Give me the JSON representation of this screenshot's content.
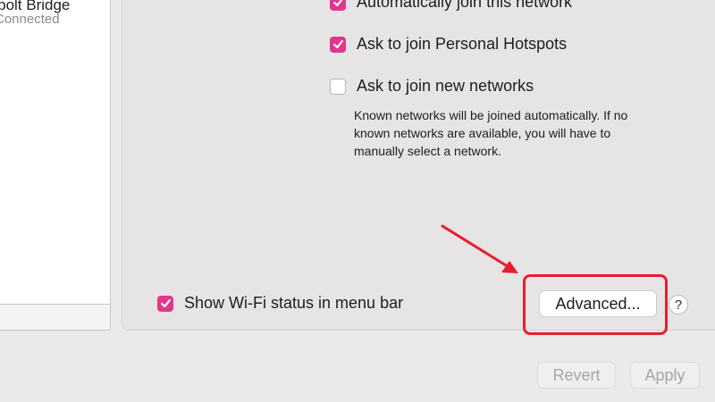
{
  "sidebar": {
    "network_name": "erbolt Bridge",
    "network_status": "Connected"
  },
  "options": {
    "auto_join": {
      "label": "Automatically join this network",
      "checked": true
    },
    "ask_hotspots": {
      "label": "Ask to join Personal Hotspots",
      "checked": true
    },
    "ask_new": {
      "label": "Ask to join new networks",
      "checked": false
    },
    "help_text": "Known networks will be joined automatically. If no known networks are available, you will have to manually select a network.",
    "show_status": {
      "label": "Show Wi-Fi status in menu bar",
      "checked": true
    }
  },
  "buttons": {
    "advanced": "Advanced...",
    "help": "?",
    "revert": "Revert",
    "apply": "Apply"
  },
  "colors": {
    "accent": "#e2368c",
    "annotation": "#e5202e"
  }
}
